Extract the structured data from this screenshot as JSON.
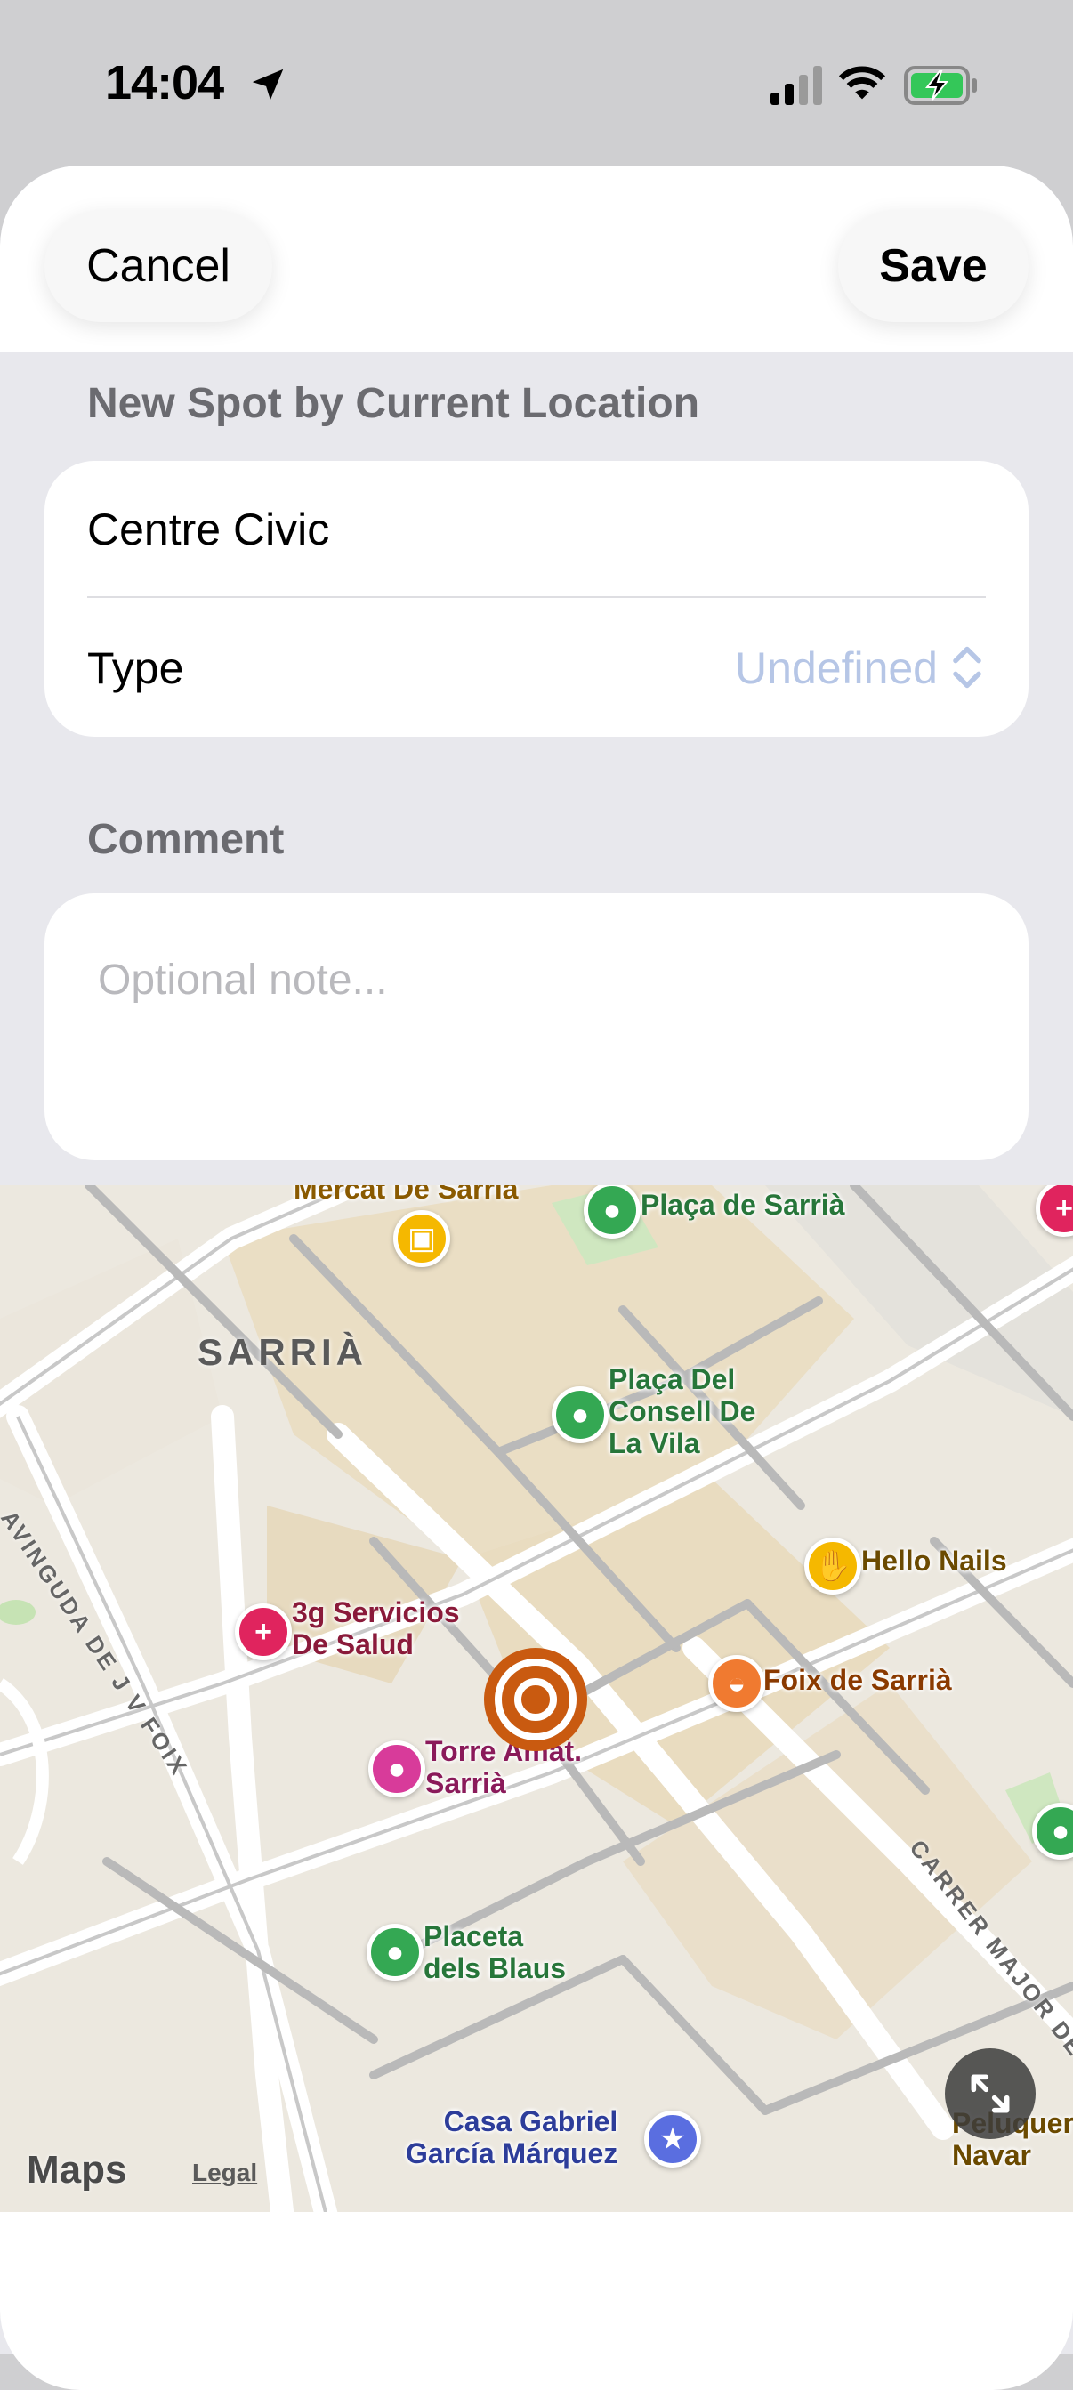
{
  "status_bar": {
    "time": "14:04"
  },
  "header": {
    "cancel_label": "Cancel",
    "save_label": "Save"
  },
  "form": {
    "section_title": "New Spot by Current Location",
    "name_value": "Centre Civic",
    "type_label": "Type",
    "type_value": "Undefined",
    "comment_title": "Comment",
    "comment_placeholder": "Optional note..."
  },
  "map": {
    "district": "SARRIÀ",
    "streets": [
      "AVINGUDA DE J V FOIX",
      "CARRER MAJOR DE"
    ],
    "pois": [
      {
        "name": "Mercat De Sarrià"
      },
      {
        "name": "Plaça de Sarrià"
      },
      {
        "name": "Plaça Del\nConsell De\nLa Vila"
      },
      {
        "name": "Hello Nails"
      },
      {
        "name": "3g Servicios\nDe Salud"
      },
      {
        "name": "Foix de Sarrià"
      },
      {
        "name": "Torre Amat.\nSarrià"
      },
      {
        "name": "Placeta\ndels Blaus"
      },
      {
        "name": "Casa Gabriel\nGarcía Márquez"
      },
      {
        "name": "Peluquer\nNavar"
      }
    ],
    "maps_brand": "Maps",
    "legal_label": "Legal"
  }
}
